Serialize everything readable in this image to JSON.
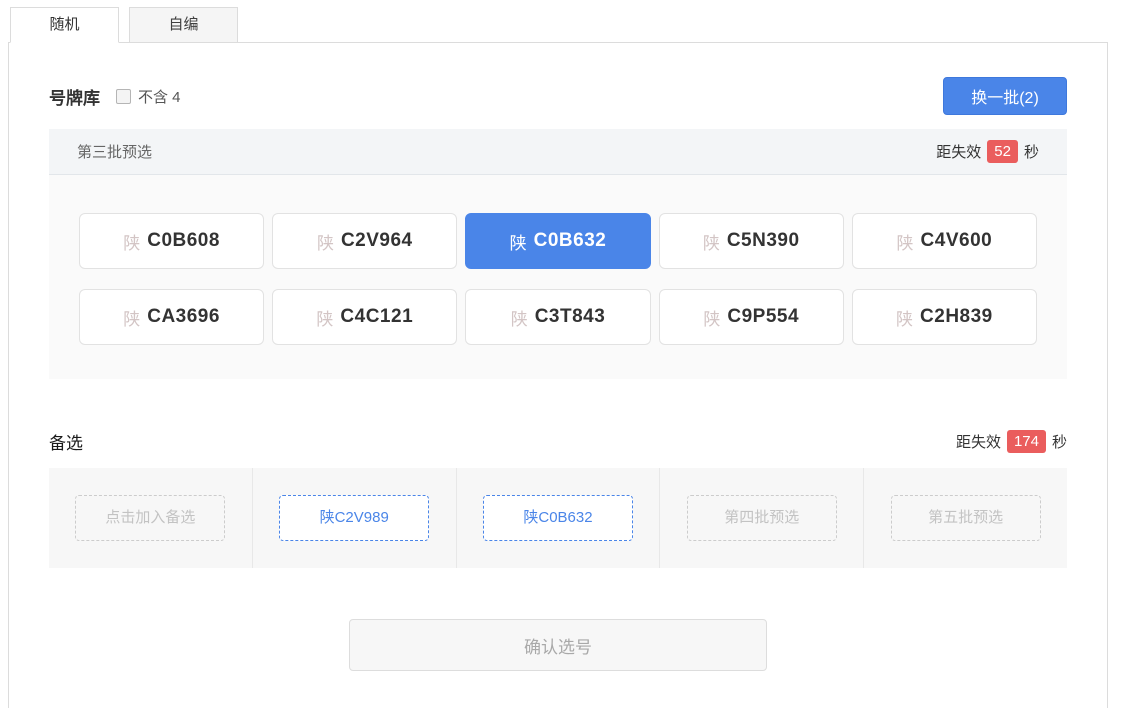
{
  "tabs": [
    {
      "label": "随机"
    },
    {
      "label": "自编"
    }
  ],
  "pool": {
    "title": "号牌库",
    "checkbox_label": "不含 4",
    "checkbox_checked": false,
    "refresh_button_label": "换一批(2)"
  },
  "batch": {
    "title": "第三批预选",
    "expiry_prefix": "距失效",
    "expiry_seconds": "52",
    "expiry_suffix": "秒",
    "plates": [
      {
        "prefix": "陕",
        "code": "C0B608",
        "selected": false
      },
      {
        "prefix": "陕",
        "code": "C2V964",
        "selected": false
      },
      {
        "prefix": "陕",
        "code": "C0B632",
        "selected": true
      },
      {
        "prefix": "陕",
        "code": "C5N390",
        "selected": false
      },
      {
        "prefix": "陕",
        "code": "C4V600",
        "selected": false
      },
      {
        "prefix": "陕",
        "code": "CA3696",
        "selected": false
      },
      {
        "prefix": "陕",
        "code": "C4C121",
        "selected": false
      },
      {
        "prefix": "陕",
        "code": "C3T843",
        "selected": false
      },
      {
        "prefix": "陕",
        "code": "C9P554",
        "selected": false
      },
      {
        "prefix": "陕",
        "code": "C2H839",
        "selected": false
      }
    ]
  },
  "alternatives": {
    "title": "备选",
    "expiry_prefix": "距失效",
    "expiry_seconds": "174",
    "expiry_suffix": "秒",
    "slots": [
      {
        "label": "点击加入备选",
        "state": "placeholder"
      },
      {
        "label": "陕C2V989",
        "state": "filled"
      },
      {
        "label": "陕C0B632",
        "state": "filled"
      },
      {
        "label": "第四批预选",
        "state": "placeholder"
      },
      {
        "label": "第五批预选",
        "state": "placeholder"
      }
    ]
  },
  "confirm": {
    "label": "确认选号"
  },
  "colors": {
    "accent_blue": "#4a85e8",
    "badge_red": "#ea5d5d"
  }
}
